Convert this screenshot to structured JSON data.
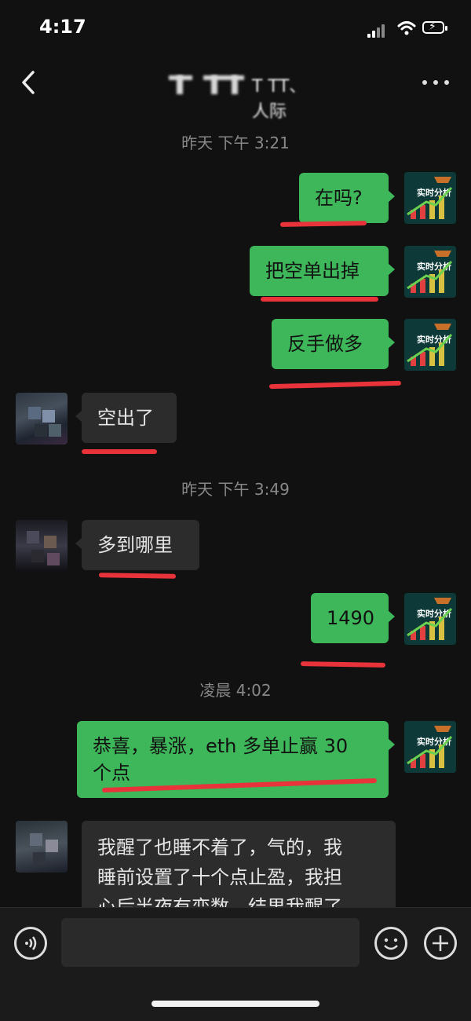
{
  "status": {
    "time": "4:17"
  },
  "header": {
    "title": "Т ТТ、人际"
  },
  "timestamps": {
    "t1": "昨天 下午 3:21",
    "t2": "昨天 下午 3:49",
    "t3": "凌晨 4:02"
  },
  "messages": [
    {
      "from": "me",
      "text": "在吗?"
    },
    {
      "from": "me",
      "text": "把空单出掉"
    },
    {
      "from": "me",
      "text": "反手做多"
    },
    {
      "from": "other",
      "text": "空出了"
    },
    {
      "from": "other",
      "text": "多到哪里"
    },
    {
      "from": "me",
      "text": "1490"
    },
    {
      "from": "me",
      "line1": "恭喜，暴涨，eth 多单止赢 30",
      "line2": "个点"
    },
    {
      "from": "other",
      "line1": "我醒了也睡不着了，气的，我",
      "line2": "睡前设置了十个点止盈，我担",
      "line3": "心后半夜有变数，结果我醒了"
    }
  ],
  "avatar_me": {
    "text": "实时分析"
  },
  "colors": {
    "bubble_me": "#3eb65a",
    "bubble_other": "#2c2c2c",
    "annotation": "#e8333a"
  },
  "icons": [
    "back-icon",
    "more-icon",
    "voice-icon",
    "emoji-icon",
    "plus-icon"
  ]
}
